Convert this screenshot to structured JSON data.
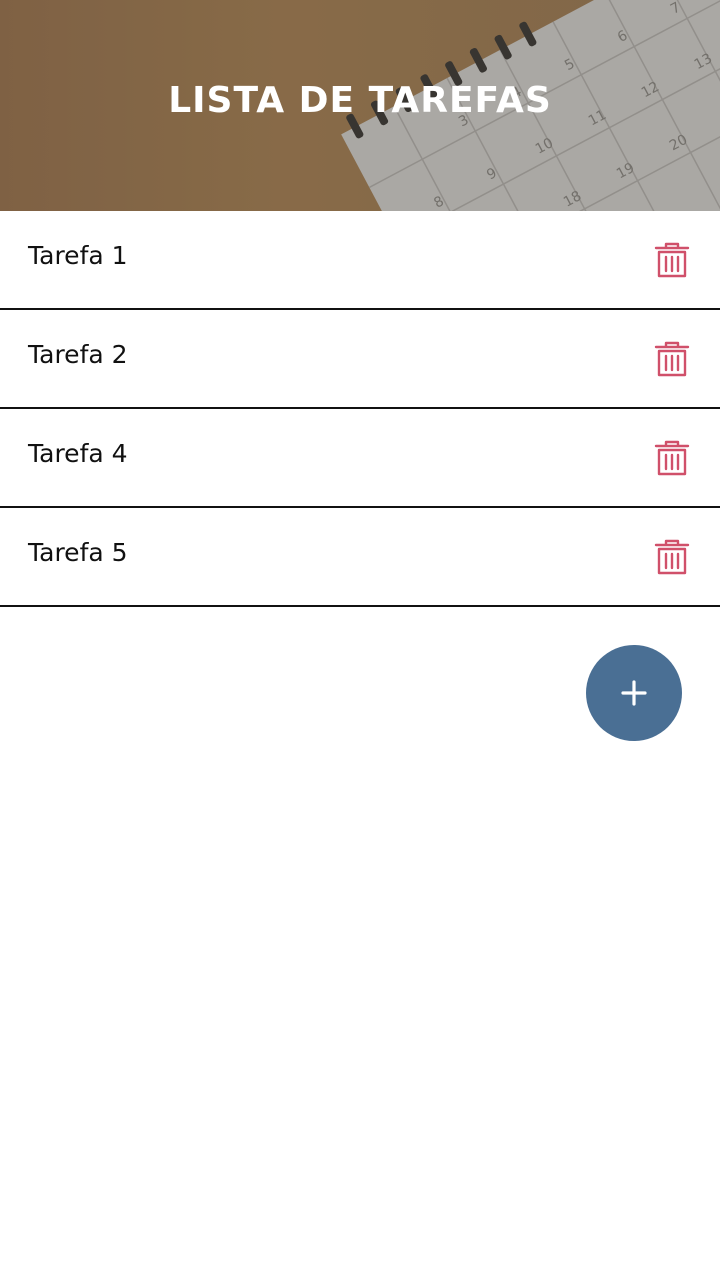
{
  "header": {
    "title": "LISTA DE TAREFAS",
    "background_icon": "calendar-photo"
  },
  "tasks": [
    {
      "label": "Tarefa 1",
      "action_icon": "trash-icon"
    },
    {
      "label": "Tarefa 2",
      "action_icon": "trash-icon"
    },
    {
      "label": "Tarefa 4",
      "action_icon": "trash-icon"
    },
    {
      "label": "Tarefa 5",
      "action_icon": "trash-icon"
    }
  ],
  "fab": {
    "icon": "plus-icon",
    "symbol": "+"
  },
  "colors": {
    "trash": "#d0506a",
    "fab": "#4a6f94",
    "header_bg": "#8a6a4a",
    "divider": "#111111"
  }
}
